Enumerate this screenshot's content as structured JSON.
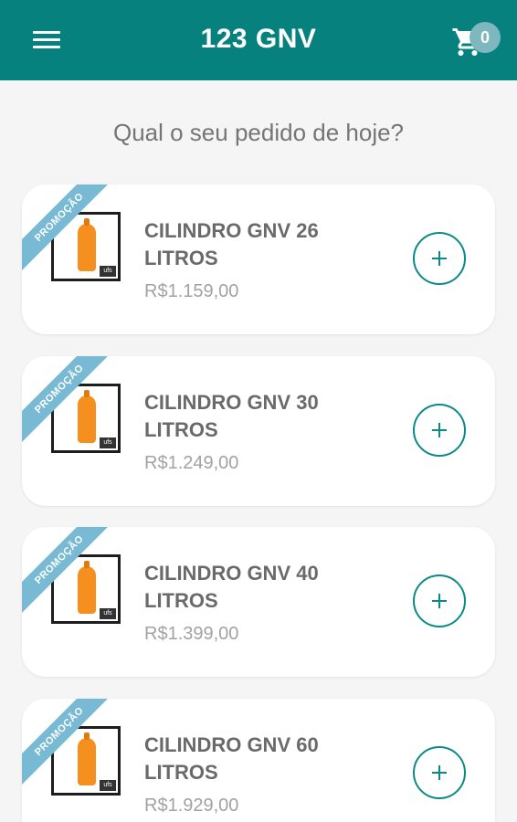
{
  "header": {
    "title": "123 GNV",
    "cart_count": "0"
  },
  "prompt": "Qual o seu pedido de hoje?",
  "products": [
    {
      "badge": "PROMOÇÃO",
      "name": "CILINDRO GNV 26 LITROS",
      "price": "R$1.159,00",
      "thumb_logo": "ufs"
    },
    {
      "badge": "PROMOÇÃO",
      "name": "CILINDRO GNV 30 LITROS",
      "price": "R$1.249,00",
      "thumb_logo": "ufs"
    },
    {
      "badge": "PROMOÇÃO",
      "name": "CILINDRO GNV 40 LITROS",
      "price": "R$1.399,00",
      "thumb_logo": "ufs"
    },
    {
      "badge": "PROMOÇÃO",
      "name": "CILINDRO GNV 60 LITROS",
      "price": "R$1.929,00",
      "thumb_logo": "ufs"
    }
  ],
  "icons": {
    "menu": "hamburger-menu-icon",
    "cart": "shopping-cart-icon",
    "add": "plus-circle-icon"
  },
  "colors": {
    "primary": "#07817d",
    "badge": "#7fb7bf",
    "ribbon": "#78b9d3",
    "cylinder": "#f5901e"
  }
}
